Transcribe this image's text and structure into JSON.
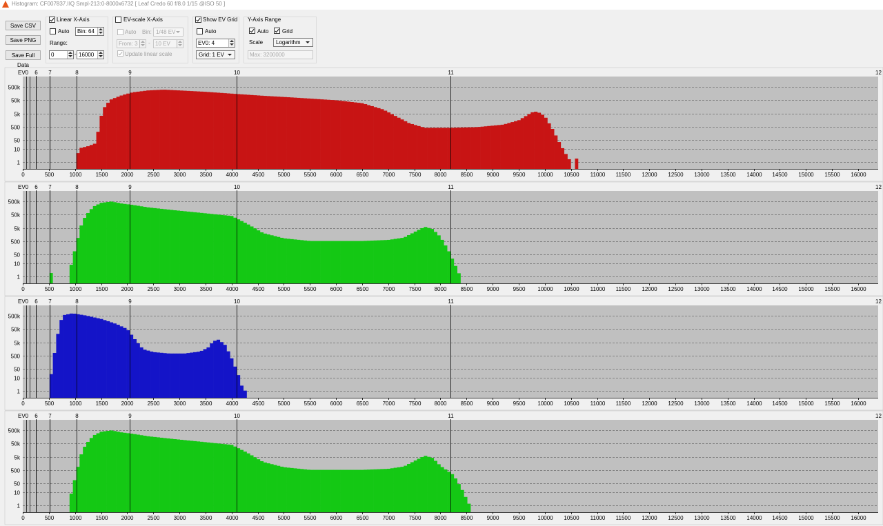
{
  "window": {
    "title": "Histogram: CF007837.IIQ Smpl-213:0-8000x6732 [ Leaf Credo 60 f/8.0 1/15 @ISO 50 ]"
  },
  "buttons": {
    "save_csv": "Save CSV",
    "save_png": "Save PNG",
    "save_full": "Save Full Data"
  },
  "linear_x": {
    "title": "Linear X-Axis",
    "checked": true,
    "auto_label": "Auto",
    "auto_checked": false,
    "bin": "Bin: 64",
    "range_label": "Range:",
    "range_from": "0",
    "range_sep": "-",
    "range_to": "16000"
  },
  "ev_x": {
    "title": "EV-scale X-Axis",
    "checked": false,
    "auto_label": "Auto",
    "bin_label": "Bin:",
    "bin_value": "1/48 EV",
    "from": "From: 3",
    "sep": "-",
    "to": "10 EV",
    "update_label": "Update linear scale"
  },
  "ev_grid": {
    "title": "Show EV Grid",
    "checked": true,
    "auto_label": "Auto",
    "auto_checked": false,
    "ev0": "EV0: 4",
    "grid": "Grid: 1 EV"
  },
  "y_axis": {
    "title": "Y-Axis Range",
    "auto_label": "Auto",
    "auto_checked": true,
    "grid_label": "Grid",
    "grid_checked": true,
    "scale_label": "Scale",
    "scale_value": "Logarithm",
    "max": "Max: 3200000"
  },
  "plot_common": {
    "ev_axis_title": "EV0",
    "ev_markers": [
      {
        "label": "6",
        "x": 256
      },
      {
        "label": "7",
        "x": 512
      },
      {
        "label": "8",
        "x": 1024
      },
      {
        "label": "9",
        "x": 2048
      },
      {
        "label": "10",
        "x": 4096
      },
      {
        "label": "11",
        "x": 8192
      },
      {
        "label": "12",
        "x": 16384
      }
    ],
    "ev_minor_lines": [
      64,
      128,
      256,
      512
    ],
    "y_ticks": [
      "1",
      "10",
      "50",
      "500",
      "5k",
      "50k",
      "500k"
    ],
    "y_tick_values": [
      1,
      10,
      50,
      500,
      5000,
      50000,
      500000
    ],
    "x_ticks": [
      0,
      500,
      1000,
      1500,
      2000,
      2500,
      3000,
      3500,
      4000,
      4500,
      5000,
      5500,
      6000,
      6500,
      7000,
      7500,
      8000,
      8500,
      9000,
      9500,
      10000,
      10500,
      11000,
      11500,
      12000,
      12500,
      13000,
      13500,
      14000,
      14500,
      15000,
      15500,
      16000
    ],
    "x_max": 16384,
    "y_log_range": [
      0.3,
      3200000
    ],
    "bin_width": 64,
    "background": "#c0c0c0"
  },
  "chart_data": [
    {
      "type": "bar",
      "channel": "red",
      "color": "#c81414",
      "bin_width": 64,
      "x_range": [
        0,
        16384
      ],
      "y_scale": "log",
      "profile": [
        [
          1024,
          3
        ],
        [
          1120,
          12
        ],
        [
          1250,
          16
        ],
        [
          1380,
          25
        ],
        [
          1440,
          200
        ],
        [
          1500,
          3000
        ],
        [
          1580,
          20000
        ],
        [
          1700,
          60000
        ],
        [
          1900,
          120000
        ],
        [
          2100,
          200000
        ],
        [
          2400,
          280000
        ],
        [
          2700,
          320000
        ],
        [
          3000,
          280000
        ],
        [
          3500,
          220000
        ],
        [
          4100,
          150000
        ],
        [
          4600,
          110000
        ],
        [
          5200,
          80000
        ],
        [
          6000,
          50000
        ],
        [
          6500,
          30000
        ],
        [
          6900,
          10000
        ],
        [
          7150,
          3000
        ],
        [
          7400,
          900
        ],
        [
          7700,
          400
        ],
        [
          8200,
          400
        ],
        [
          8700,
          450
        ],
        [
          9200,
          700
        ],
        [
          9500,
          1500
        ],
        [
          9750,
          6000
        ],
        [
          9850,
          7000
        ],
        [
          10000,
          3000
        ],
        [
          10150,
          300
        ],
        [
          10300,
          20
        ],
        [
          10420,
          3
        ],
        [
          10500,
          1
        ]
      ],
      "isolated": [
        [
          10576,
          1
        ]
      ]
    },
    {
      "type": "bar",
      "channel": "green",
      "color": "#14c814",
      "bin_width": 64,
      "x_range": [
        0,
        16384
      ],
      "y_scale": "log",
      "profile": [
        [
          896,
          2
        ],
        [
          960,
          30
        ],
        [
          1020,
          200
        ],
        [
          1100,
          5000
        ],
        [
          1200,
          40000
        ],
        [
          1350,
          200000
        ],
        [
          1500,
          400000
        ],
        [
          1700,
          500000
        ],
        [
          1900,
          350000
        ],
        [
          2100,
          280000
        ],
        [
          2400,
          180000
        ],
        [
          2900,
          110000
        ],
        [
          3400,
          70000
        ],
        [
          4000,
          40000
        ],
        [
          4300,
          10000
        ],
        [
          4600,
          2000
        ],
        [
          5000,
          800
        ],
        [
          5500,
          500
        ],
        [
          6500,
          500
        ],
        [
          7000,
          600
        ],
        [
          7300,
          900
        ],
        [
          7550,
          3000
        ],
        [
          7700,
          6000
        ],
        [
          7850,
          4000
        ],
        [
          8000,
          1000
        ],
        [
          8150,
          100
        ],
        [
          8300,
          5
        ],
        [
          8380,
          1
        ]
      ],
      "isolated": [
        [
          512,
          1
        ]
      ]
    },
    {
      "type": "bar",
      "channel": "blue",
      "color": "#1414c8",
      "bin_width": 64,
      "x_range": [
        0,
        16384
      ],
      "y_scale": "log",
      "profile": [
        [
          512,
          3
        ],
        [
          580,
          150
        ],
        [
          640,
          5000
        ],
        [
          720,
          200000
        ],
        [
          800,
          600000
        ],
        [
          950,
          800000
        ],
        [
          1200,
          550000
        ],
        [
          1500,
          300000
        ],
        [
          1800,
          120000
        ],
        [
          2000,
          50000
        ],
        [
          2150,
          8000
        ],
        [
          2300,
          1500
        ],
        [
          2500,
          900
        ],
        [
          2800,
          700
        ],
        [
          3100,
          700
        ],
        [
          3400,
          1000
        ],
        [
          3550,
          2000
        ],
        [
          3650,
          6000
        ],
        [
          3750,
          8000
        ],
        [
          3880,
          3000
        ],
        [
          4000,
          300
        ],
        [
          4120,
          20
        ],
        [
          4200,
          2
        ],
        [
          4260,
          1
        ]
      ],
      "isolated": []
    },
    {
      "type": "bar",
      "channel": "green",
      "color": "#14c814",
      "bin_width": 64,
      "x_range": [
        0,
        16384
      ],
      "y_scale": "log",
      "profile": [
        [
          896,
          2
        ],
        [
          960,
          30
        ],
        [
          1020,
          200
        ],
        [
          1100,
          5000
        ],
        [
          1200,
          40000
        ],
        [
          1350,
          200000
        ],
        [
          1500,
          400000
        ],
        [
          1700,
          500000
        ],
        [
          1900,
          350000
        ],
        [
          2100,
          280000
        ],
        [
          2400,
          180000
        ],
        [
          2900,
          110000
        ],
        [
          3400,
          70000
        ],
        [
          4000,
          40000
        ],
        [
          4300,
          10000
        ],
        [
          4600,
          2000
        ],
        [
          5000,
          800
        ],
        [
          5500,
          500
        ],
        [
          6500,
          500
        ],
        [
          7000,
          600
        ],
        [
          7300,
          900
        ],
        [
          7550,
          3000
        ],
        [
          7700,
          6000
        ],
        [
          7850,
          4000
        ],
        [
          8000,
          1000
        ],
        [
          8250,
          200
        ],
        [
          8400,
          20
        ],
        [
          8500,
          3
        ],
        [
          8560,
          1
        ]
      ],
      "isolated": []
    }
  ]
}
